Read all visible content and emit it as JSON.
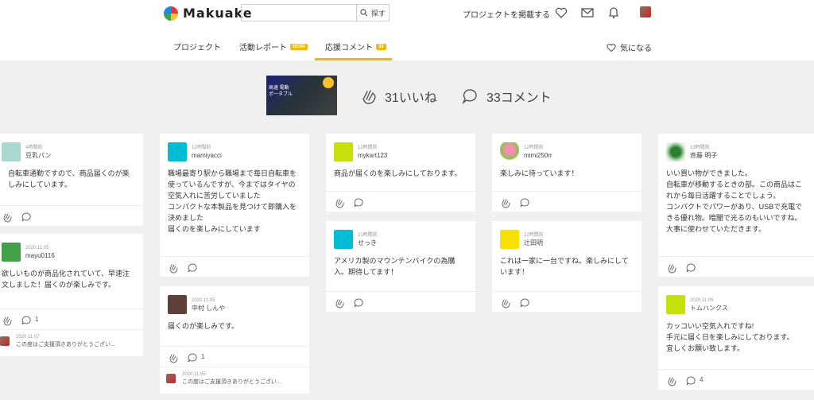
{
  "header": {
    "logo_text": "Makuake",
    "search_placeholder": "",
    "search_button": "探す",
    "project_link": "プロジェクトを掲載する"
  },
  "tabs": [
    {
      "label": "プロジェクト"
    },
    {
      "label": "活動レポート",
      "badge": "NEW!"
    },
    {
      "label": "応援コメント",
      "badge": "33"
    }
  ],
  "favorite_label": "気になる",
  "summary": {
    "thumb_line1": "高速 電動",
    "thumb_line2": "ポータブル",
    "likes": "31いいね",
    "comments": "33コメント"
  },
  "cards": [
    {
      "time": "4時間前",
      "name": "豆乳パン",
      "text": "自転車通勤ですので、商品届くのが楽しみにしています。",
      "count": "",
      "avatar_color": "#a8d8cf"
    },
    {
      "time": "2020.11.05",
      "name": "mayu0116",
      "text": "欲しいものが商品化されていて、早速注文しました！届くのが楽しみです。",
      "count": "1",
      "avatar_color": "#43a047",
      "reply_time": "2020.11.07",
      "reply_text": "この度はご支援頂きありがとうござい..."
    },
    {
      "time": "11時間前",
      "name": "mamiyacci",
      "text": "職場最寄り駅から職場まで毎日自転車を使っているんですが、今まではタイヤの空気入れに苦労していました\nコンパクトな本製品を見つけて即購入を決めました\n届くのを楽しみにしています",
      "count": "",
      "avatar_color": "#00bcd4"
    },
    {
      "time": "2020.11.05",
      "name": "中村 しんや",
      "text": "届くのが楽しみです。",
      "count": "1",
      "avatar_color": "#5d4037",
      "reply_time": "2020.11.05",
      "reply_text": "この度はご支援頂きありがとうござい..."
    },
    {
      "time": "12時間前",
      "name": "mykart123",
      "text": "商品が届くのを楽しみにしております。",
      "count": "",
      "avatar_color": "#c6e00b"
    },
    {
      "time": "21時間前",
      "name": "せっき",
      "text": "アメリカ製のマウンテンバイクの為購入。期待してます！",
      "count": "",
      "avatar_color": "#00bcd4"
    },
    {
      "time": "12時間前",
      "name": "mimi250rr",
      "text": "楽しみに待っています！",
      "count": "",
      "avatar_color": "#d81b60"
    },
    {
      "time": "22時間前",
      "name": "辻田明",
      "text": "これは一家に一台ですね。楽しみにしています！",
      "count": "",
      "avatar_color": "#f9e000"
    },
    {
      "time": "13時間前",
      "name": "斉藤 明子",
      "text": "いい買い物ができました。\n自転車が移動するときの部。この商品はこれから毎日活躍することでしょう。\nコンパクトでパワーがあり、USBで充電できる優れ物。暗闇で光るのもいいですね。大事に使わせていただきます。",
      "count": "",
      "avatar_color": "#558b2f"
    },
    {
      "time": "2020.11.05",
      "name": "トムハンクス",
      "text": "カッコいい空気入れですね!\n手元に届く日を楽しみにしております。\n宜しくお願い致します。",
      "count": "4",
      "avatar_color": "#c6e00b"
    }
  ],
  "colors": {
    "accent": "#f5b800",
    "background": "#f0f0f0"
  }
}
